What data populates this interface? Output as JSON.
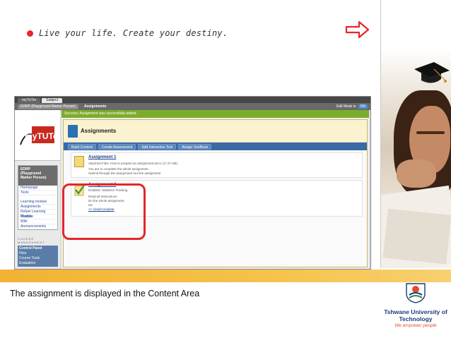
{
  "slide": {
    "tagline": "Live your life. Create your destiny.",
    "caption": "The assignment is displayed in the Content Area",
    "brand_color": "#e8262b",
    "strip_color": "#f2b233"
  },
  "logo": {
    "university": "Tshwane University of Technology",
    "slogan": "We empower people"
  },
  "lms": {
    "tabs": [
      "myTUTor",
      "Subject"
    ],
    "breadcrumb": [
      "EDRP (Playground Marker Person)",
      "Assignments"
    ],
    "edit_mode_label": "Edit Mode is",
    "edit_mode_value": "ON",
    "brand_text": "myTUTor",
    "success_message": "Success: Assignment was successfully added.",
    "page_title": "Assignments",
    "toolbar": [
      "Build Content",
      "Create Assessment",
      "Add Interactive Tool",
      "Assign TextBook"
    ],
    "course_menu": {
      "header": [
        "EDRP",
        "(Playground",
        "Marker Person)"
      ],
      "items_group1": [
        "Homepage",
        "Tools"
      ],
      "items_group2": [
        "Learning module",
        "Assignments",
        "Refuel Learning Module",
        "Practice",
        "Wiki",
        "Announcements"
      ]
    },
    "course_management": {
      "title": "COURSE MANAGEMENT",
      "header": "Control Panel",
      "items": [
        "Files",
        "Course Tools",
        "Evaluation"
      ]
    },
    "items": [
      {
        "title": "Assignment 1",
        "lines": [
          "Attached Files: How to prepare an assignment.docx (17.27 KB)",
          "You are to complete the whole assignment",
          "Submit through the assignment tool the assignment"
        ]
      },
      {
        "title": "Assignment 2",
        "lines": [
          "Enabled: Statistics Tracking",
          "Read all instructions",
          "Do the whole assignment",
          "etc",
          ">> View/Complete"
        ]
      }
    ]
  }
}
